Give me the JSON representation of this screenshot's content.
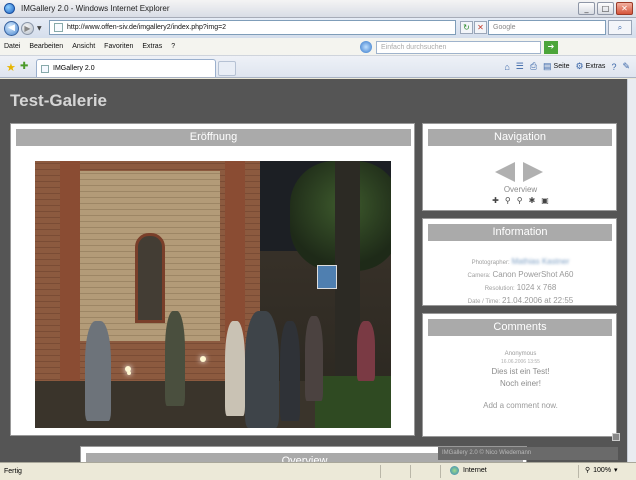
{
  "window": {
    "title": "IMGallery 2.0 - Windows Internet Explorer",
    "controls": [
      "_",
      "□",
      "✕"
    ]
  },
  "address": {
    "url": "http://www.offen-siv.de/imgallery2/index.php?img=2",
    "search_placeholder": "Google"
  },
  "menu": {
    "items": [
      "Datei",
      "Bearbeiten",
      "Ansicht",
      "Favoriten",
      "Extras",
      "?"
    ],
    "web_search_placeholder": "Einfach durchsuchen"
  },
  "tabs": {
    "active_label": "IMGallery 2.0",
    "commands": [
      "Seite",
      "Extras"
    ]
  },
  "page": {
    "site_title": "Test-Galerie",
    "main_header": "Eröffnung",
    "navigation": {
      "header": "Navigation",
      "overview_label": "Overview",
      "icons": [
        "zoom-in-icon",
        "zoom-out-icon",
        "magnifier-icon",
        "settings-icon",
        "save-icon"
      ]
    },
    "information": {
      "header": "Information",
      "rows": [
        {
          "key": "Photographer:",
          "value": "Mathias Kastner"
        },
        {
          "key": "Camera:",
          "value": "Canon PowerShot A60"
        },
        {
          "key": "Resolution:",
          "value": "1024 x 768"
        },
        {
          "key": "Date / Time:",
          "value": "21.04.2006 at 22:55"
        }
      ]
    },
    "comments": {
      "header": "Comments",
      "author": "Anonymous",
      "date": "16.06.2006 13:55",
      "line1": "Dies ist ein Test!",
      "line2": "Noch einer!",
      "add_link": "Add a comment now."
    },
    "overview_header": "Overview",
    "footer_credit": "IMGallery 2.0 © Nico Wiedemann"
  },
  "status": {
    "text": "Fertig",
    "zone": "Internet",
    "zoom": "100%"
  },
  "colors": {
    "page_background": "#555555",
    "panel_header": "#aaaaaa",
    "panel_background": "#ffffff"
  }
}
